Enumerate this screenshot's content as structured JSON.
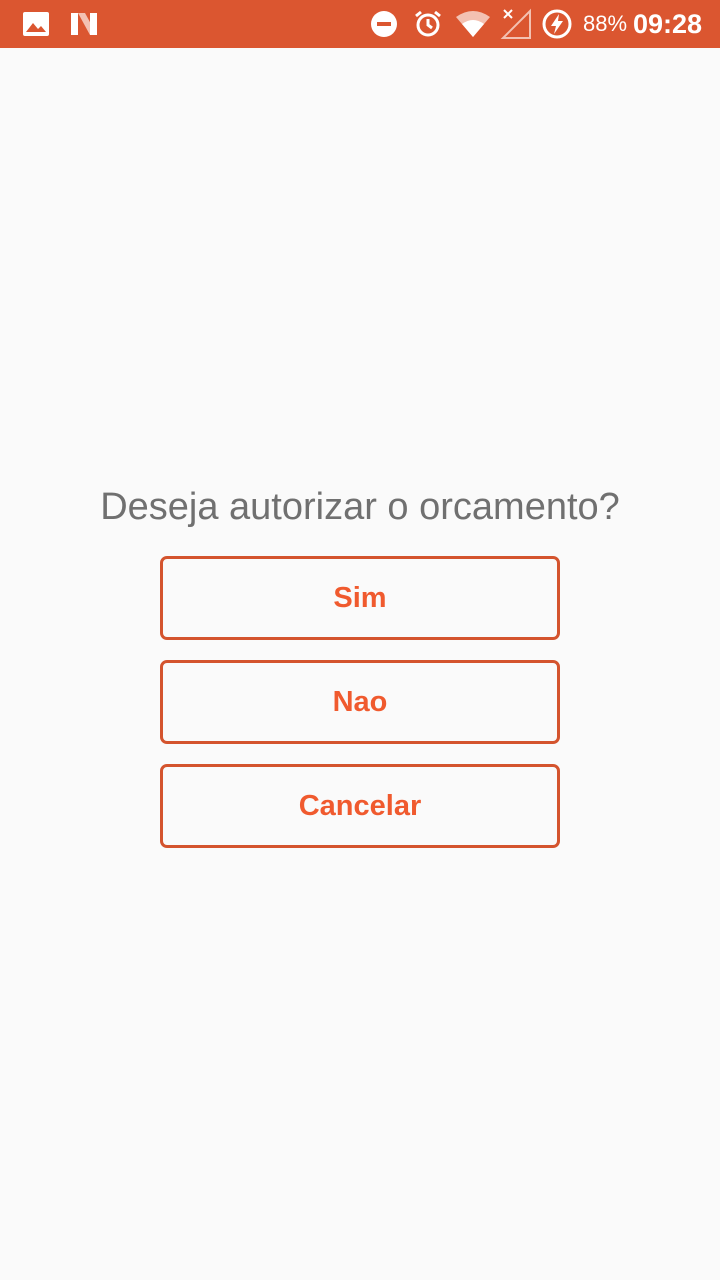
{
  "status_bar": {
    "icons_left": [
      "image-icon",
      "n-logo-icon"
    ],
    "icons_right": [
      "do-not-disturb-icon",
      "alarm-icon",
      "wifi-icon",
      "no-signal-icon",
      "battery-charging-icon"
    ],
    "battery_percent": "88%",
    "time": "09:28",
    "background_color": "#db5630"
  },
  "dialog": {
    "question": "Deseja autorizar o orcamento?",
    "buttons": {
      "yes": "Sim",
      "no": "Nao",
      "cancel": "Cancelar"
    },
    "accent_color": "#f05a2e",
    "border_color": "#d4542e",
    "text_color": "#707070"
  }
}
